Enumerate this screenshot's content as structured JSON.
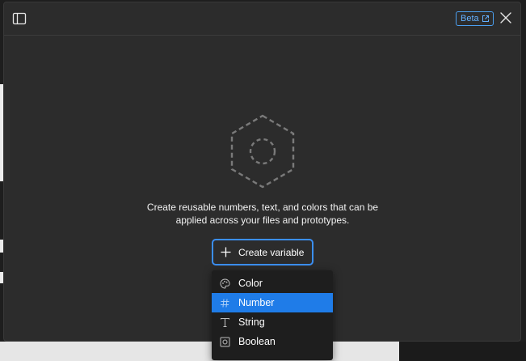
{
  "header": {
    "badge_label": "Beta"
  },
  "empty_state": {
    "line1": "Create reusable numbers, text, and colors that can be",
    "line2": "applied across your files and prototypes."
  },
  "create_button": {
    "label": "Create variable"
  },
  "menu": {
    "items": [
      {
        "label": "Color",
        "icon": "palette-icon",
        "active": false
      },
      {
        "label": "Number",
        "icon": "hash-icon",
        "active": true
      },
      {
        "label": "String",
        "icon": "text-t-icon",
        "active": false
      },
      {
        "label": "Boolean",
        "icon": "toggle-square-icon",
        "active": false
      }
    ]
  },
  "colors": {
    "accent": "#1f7ce8",
    "badge": "#4b9ff0",
    "dialog_bg": "#2c2c2c",
    "menu_bg": "#1e1e1e"
  }
}
